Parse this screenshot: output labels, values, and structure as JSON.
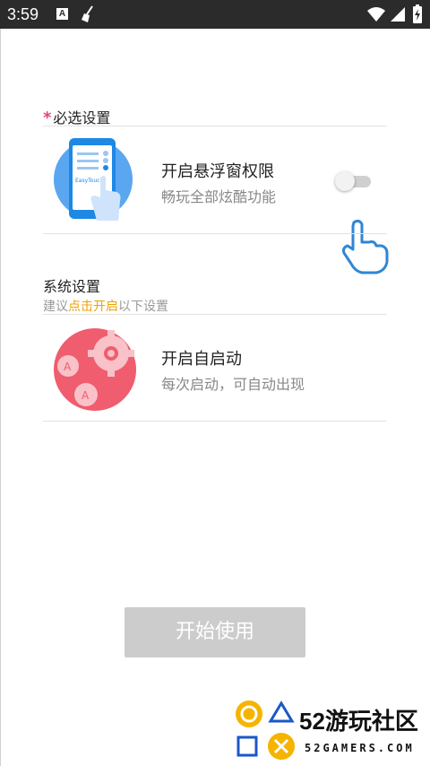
{
  "status_bar": {
    "time": "3:59",
    "notif_icon": "A"
  },
  "required": {
    "star": "*",
    "title": "必选设置",
    "item": {
      "title": "开启悬浮窗权限",
      "subtitle": "畅玩全部炫酷功能",
      "illustration_text": "EasyTouch",
      "toggle_on": false
    }
  },
  "system": {
    "title": "系统设置",
    "hint_prefix": "建议",
    "hint_highlight": "点击开启",
    "hint_suffix": "以下设置",
    "item": {
      "title": "开启自启动",
      "subtitle": "每次启动，可自动出现",
      "gear_letter": "A"
    }
  },
  "start_button": "开始使用",
  "watermark": {
    "brand": "52游玩社区",
    "domain": "52GAMERS.COM"
  },
  "colors": {
    "accent_star": "#e0457b",
    "hint_highlight": "#f0a100",
    "button_disabled": "#cccccc",
    "illustration_blue": "#1e88e5",
    "illustration_red": "#ef5d6e"
  }
}
